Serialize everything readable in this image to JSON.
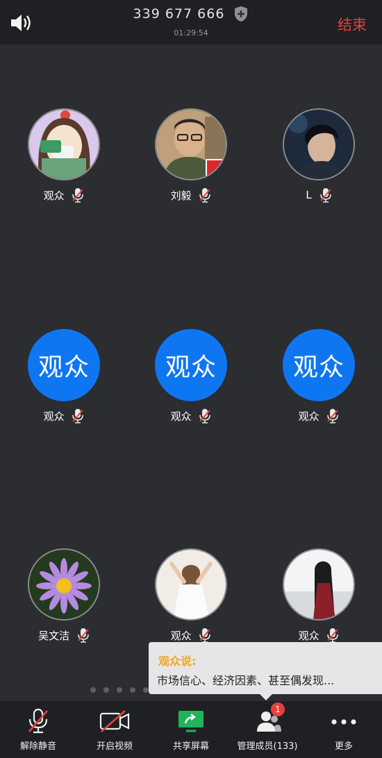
{
  "header": {
    "meeting_id": "339 677 666",
    "timer": "01:29:54",
    "end_label": "结束"
  },
  "participants": [
    {
      "name": "观众",
      "avatar": "cartoon-girl"
    },
    {
      "name": "刘毅",
      "avatar": "man-glasses"
    },
    {
      "name": "L",
      "avatar": "man-dark-hair"
    },
    {
      "name": "观众",
      "avatar_text": "观众"
    },
    {
      "name": "观众",
      "avatar_text": "观众"
    },
    {
      "name": "观众",
      "avatar_text": "观众"
    },
    {
      "name": "吴文洁",
      "avatar": "purple-flower"
    },
    {
      "name": "观众",
      "avatar": "girl-white-dress"
    },
    {
      "name": "观众",
      "avatar": "girl-long-hair"
    }
  ],
  "chat": {
    "sender": "观众说:",
    "message": "市场信心、经济因素、甚至偶发现..."
  },
  "pagination": {
    "page_count": 15,
    "active_index": 5
  },
  "toolbar": {
    "unmute_label": "解除静音",
    "video_label": "开启视频",
    "share_label": "共享屏幕",
    "members_label": "管理成员(133)",
    "members_badge": "1",
    "more_label": "更多"
  },
  "colors": {
    "background": "#2b2d31",
    "bar": "#1f2023",
    "accent_blue": "#0f76f2",
    "end_red": "#e5413b",
    "share_green": "#1fb35b",
    "chat_sender": "#f0a526"
  }
}
